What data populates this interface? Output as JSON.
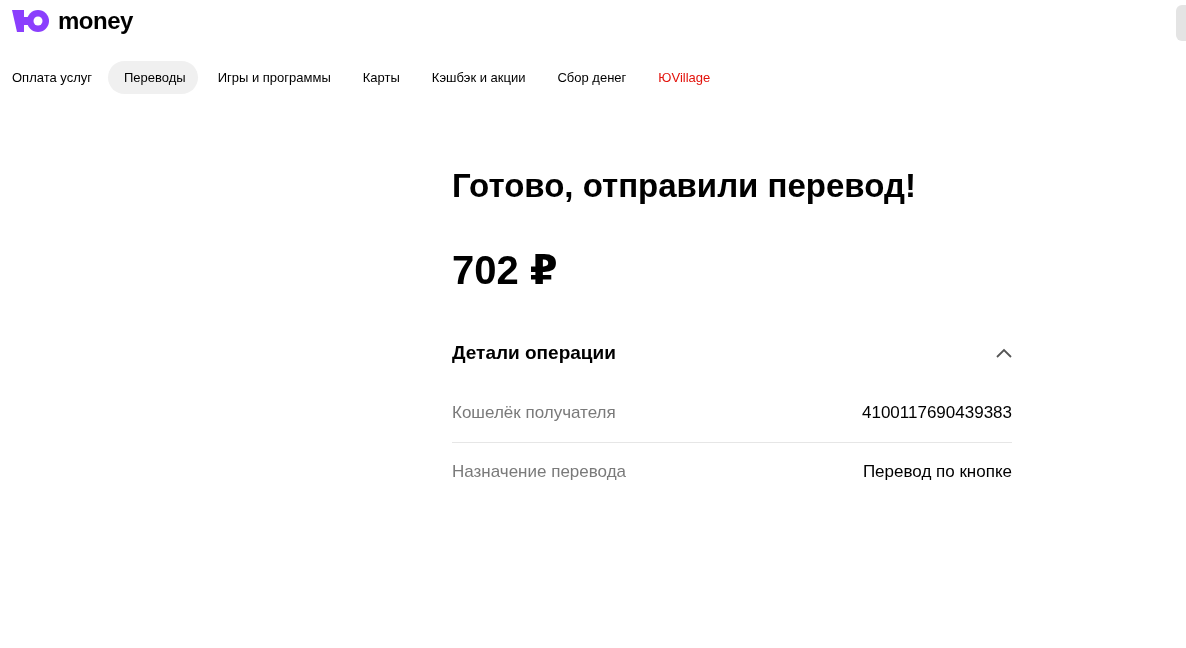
{
  "logo": {
    "text": "money"
  },
  "nav": [
    {
      "label": "Оплата услуг",
      "selected": false,
      "kind": "regular"
    },
    {
      "label": "Переводы",
      "selected": true,
      "kind": "regular"
    },
    {
      "label": "Игры и программы",
      "selected": false,
      "kind": "regular"
    },
    {
      "label": "Карты",
      "selected": false,
      "kind": "regular"
    },
    {
      "label": "Кэшбэк и акции",
      "selected": false,
      "kind": "regular"
    },
    {
      "label": "Сбор денег",
      "selected": false,
      "kind": "regular"
    },
    {
      "label": "ЮVillage",
      "selected": false,
      "kind": "promo"
    }
  ],
  "result": {
    "title": "Готово, отправили перевод!",
    "amount": "702 ₽"
  },
  "details": {
    "title": "Детали операции",
    "expanded": true,
    "rows": [
      {
        "label": "Кошелёк получателя",
        "value": "4100117690439383"
      },
      {
        "label": "Назначение перевода",
        "value": "Перевод по кнопке"
      }
    ]
  }
}
